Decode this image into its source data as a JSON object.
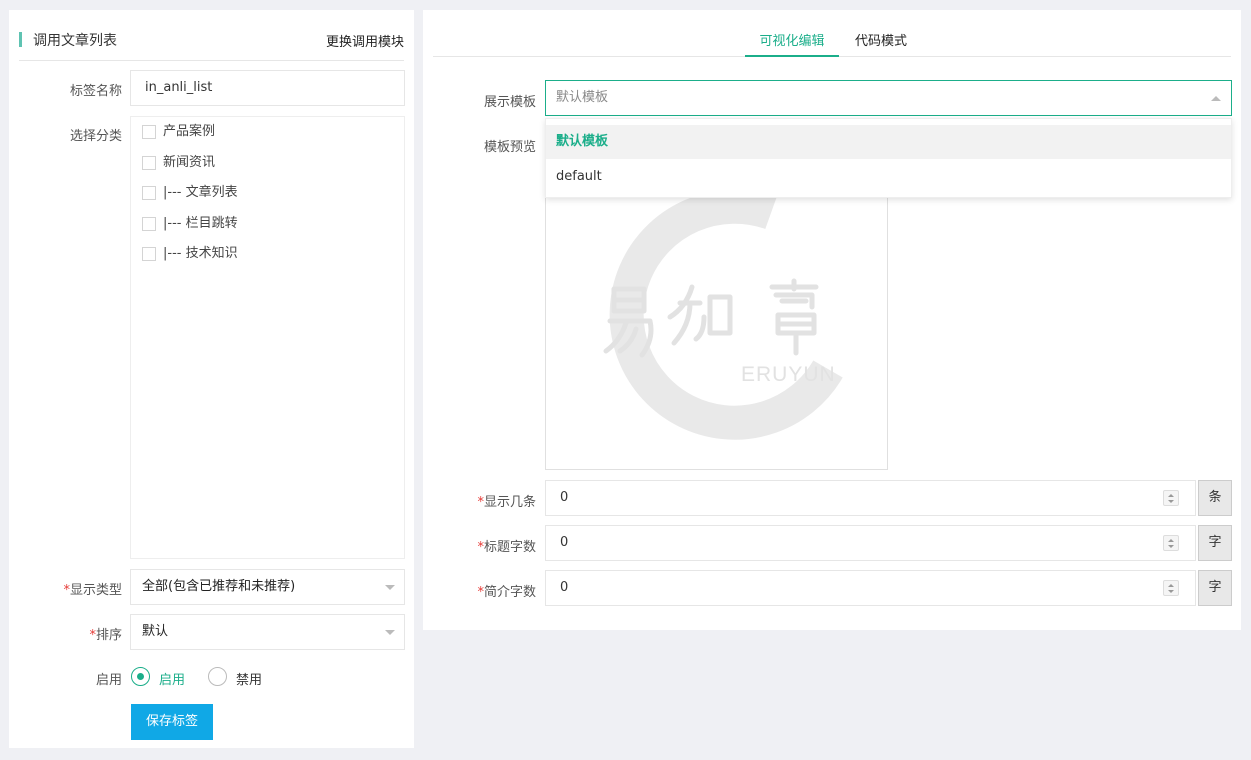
{
  "left": {
    "title": "调用文章列表",
    "switch_module": "更换调用模块",
    "tag_name_label": "标签名称",
    "tag_name_value": "in_anli_list",
    "category_label": "选择分类",
    "categories": [
      {
        "label": "产品案例",
        "checked": false
      },
      {
        "label": "新闻资讯",
        "checked": false
      },
      {
        "label": "|--- 文章列表",
        "checked": false
      },
      {
        "label": "|--- 栏目跳转",
        "checked": false
      },
      {
        "label": "|--- 技术知识",
        "checked": false
      }
    ],
    "display_type_label": "显示类型",
    "display_type_value": "全部(包含已推荐和未推荐)",
    "sort_label": "排序",
    "sort_value": "默认",
    "enable_label": "启用",
    "enable_options": [
      "启用",
      "禁用"
    ],
    "enable_selected": "启用",
    "save_button": "保存标签",
    "required_mark": "*"
  },
  "right": {
    "tabs": [
      "可视化编辑",
      "代码模式"
    ],
    "active_tab": "可视化编辑",
    "template_label": "展示模板",
    "template_placeholder": "默认模板",
    "dropdown_options": [
      "默认模板",
      "default"
    ],
    "preview_label": "模板预览",
    "preview_watermark_text": "ERUYUN",
    "count_label": "显示几条",
    "count_value": "0",
    "count_unit": "条",
    "title_len_label": "标题字数",
    "title_len_value": "0",
    "title_len_unit": "字",
    "intro_len_label": "简介字数",
    "intro_len_value": "0",
    "intro_len_unit": "字"
  },
  "colors": {
    "accent": "#1bae8a",
    "header_bar": "#5fc3b2",
    "save_button": "#10a8e6",
    "required": "#e53935",
    "background": "#eff0f4"
  }
}
